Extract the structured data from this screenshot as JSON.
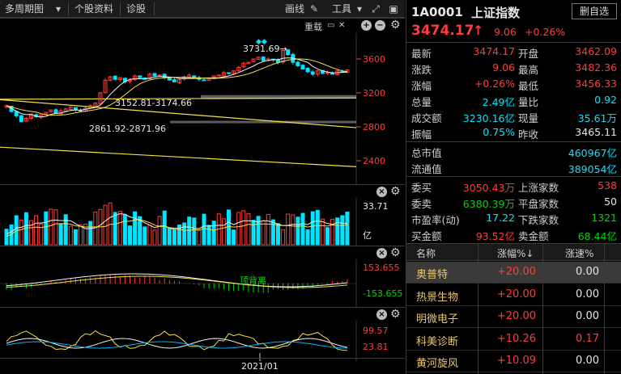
{
  "toolbar": {
    "period_label": "多周期图",
    "f10_label": "个股资料",
    "diag_label": "诊股",
    "draw_label": "画线",
    "tools_label": "工具"
  },
  "kline": {
    "overlay_label": "重载",
    "high_marker": "3731.69→",
    "band_upper_label": "3152.81-3174.66",
    "band_lower_label": "2861.92-2871.96",
    "axis_ticks": [
      "3600",
      "3200",
      "2800",
      "2400"
    ],
    "axis_values": [
      3600,
      3200,
      2800,
      2400
    ]
  },
  "volume": {
    "axis_top": "33.71",
    "axis_unit": "亿"
  },
  "macd": {
    "axis_top": "153.655",
    "axis_bottom": "-153.655",
    "annotation": "顶背离"
  },
  "osc": {
    "axis_top": "99.57",
    "axis_bottom": "23.81",
    "date_label": "2021/01"
  },
  "colors": {
    "up": "#ff3c3c",
    "down": "#00e5ff",
    "ma_white": "#f2f2f2",
    "ma_yellow": "#f5e14a",
    "annotation_green": "#00d600"
  },
  "quote": {
    "code": "1A0001",
    "name": "上证指数",
    "del_button": "删自选",
    "price": "3474.17",
    "change": "9.06",
    "change_pct": "+0.26%",
    "rows": [
      {
        "l1": "最新",
        "v1": "3474.17",
        "c1": "red",
        "l2": "开盘",
        "v2": "3462.09",
        "c2": "red"
      },
      {
        "l1": "涨跌",
        "v1": "9.06",
        "c1": "red",
        "l2": "最高",
        "v2": "3482.36",
        "c2": "red"
      },
      {
        "l1": "涨幅",
        "v1": "+0.26%",
        "c1": "red",
        "l2": "最低",
        "v2": "3456.33",
        "c2": "red"
      },
      {
        "l1": "总量",
        "v1": "2.49亿",
        "c1": "cyan",
        "l2": "量比",
        "v2": "0.92",
        "c2": "cyan"
      },
      {
        "l1": "成交额",
        "v1": "3230.16亿",
        "c1": "cyan",
        "l2": "现量",
        "v2": "35.61万",
        "c2": "cyan"
      },
      {
        "l1": "振幅",
        "v1": "0.75%",
        "c1": "cyan",
        "l2": "昨收",
        "v2": "3465.11",
        "c2": "white"
      }
    ],
    "single_rows": [
      {
        "l": "总市值",
        "v": "460967亿"
      },
      {
        "l": "流通值",
        "v": "389054亿"
      }
    ],
    "rows2": [
      {
        "l1": "委买",
        "v1": "3050.43万",
        "c1": "red",
        "l2": "上涨家数",
        "v2": "538",
        "c2": "red"
      },
      {
        "l1": "委卖",
        "v1": "6380.39万",
        "c1": "green",
        "l2": "平盘家数",
        "v2": "50",
        "c2": "white"
      },
      {
        "l1": "市盈率(动)",
        "v1": "17.22",
        "c1": "cyan",
        "l2": "下跌家数",
        "v2": "1321",
        "c2": "green"
      },
      {
        "l1": "买金额",
        "v1": "93.52亿",
        "c1": "red",
        "l2": "卖金额",
        "v2": "68.44亿",
        "c2": "green"
      }
    ]
  },
  "ranking": {
    "headers": [
      "名称",
      "涨幅%↓",
      "涨速%"
    ],
    "rows": [
      {
        "name": "奥普特",
        "pct": "+20.00",
        "spd": "0.00"
      },
      {
        "name": "热景生物",
        "pct": "+20.00",
        "spd": "0.00"
      },
      {
        "name": "明微电子",
        "pct": "+20.00",
        "spd": "0.00"
      },
      {
        "name": "科美诊断",
        "pct": "+10.26",
        "spd": "0.17"
      },
      {
        "name": "黄河旋风",
        "pct": "+10.09",
        "spd": "0.00"
      }
    ]
  }
}
